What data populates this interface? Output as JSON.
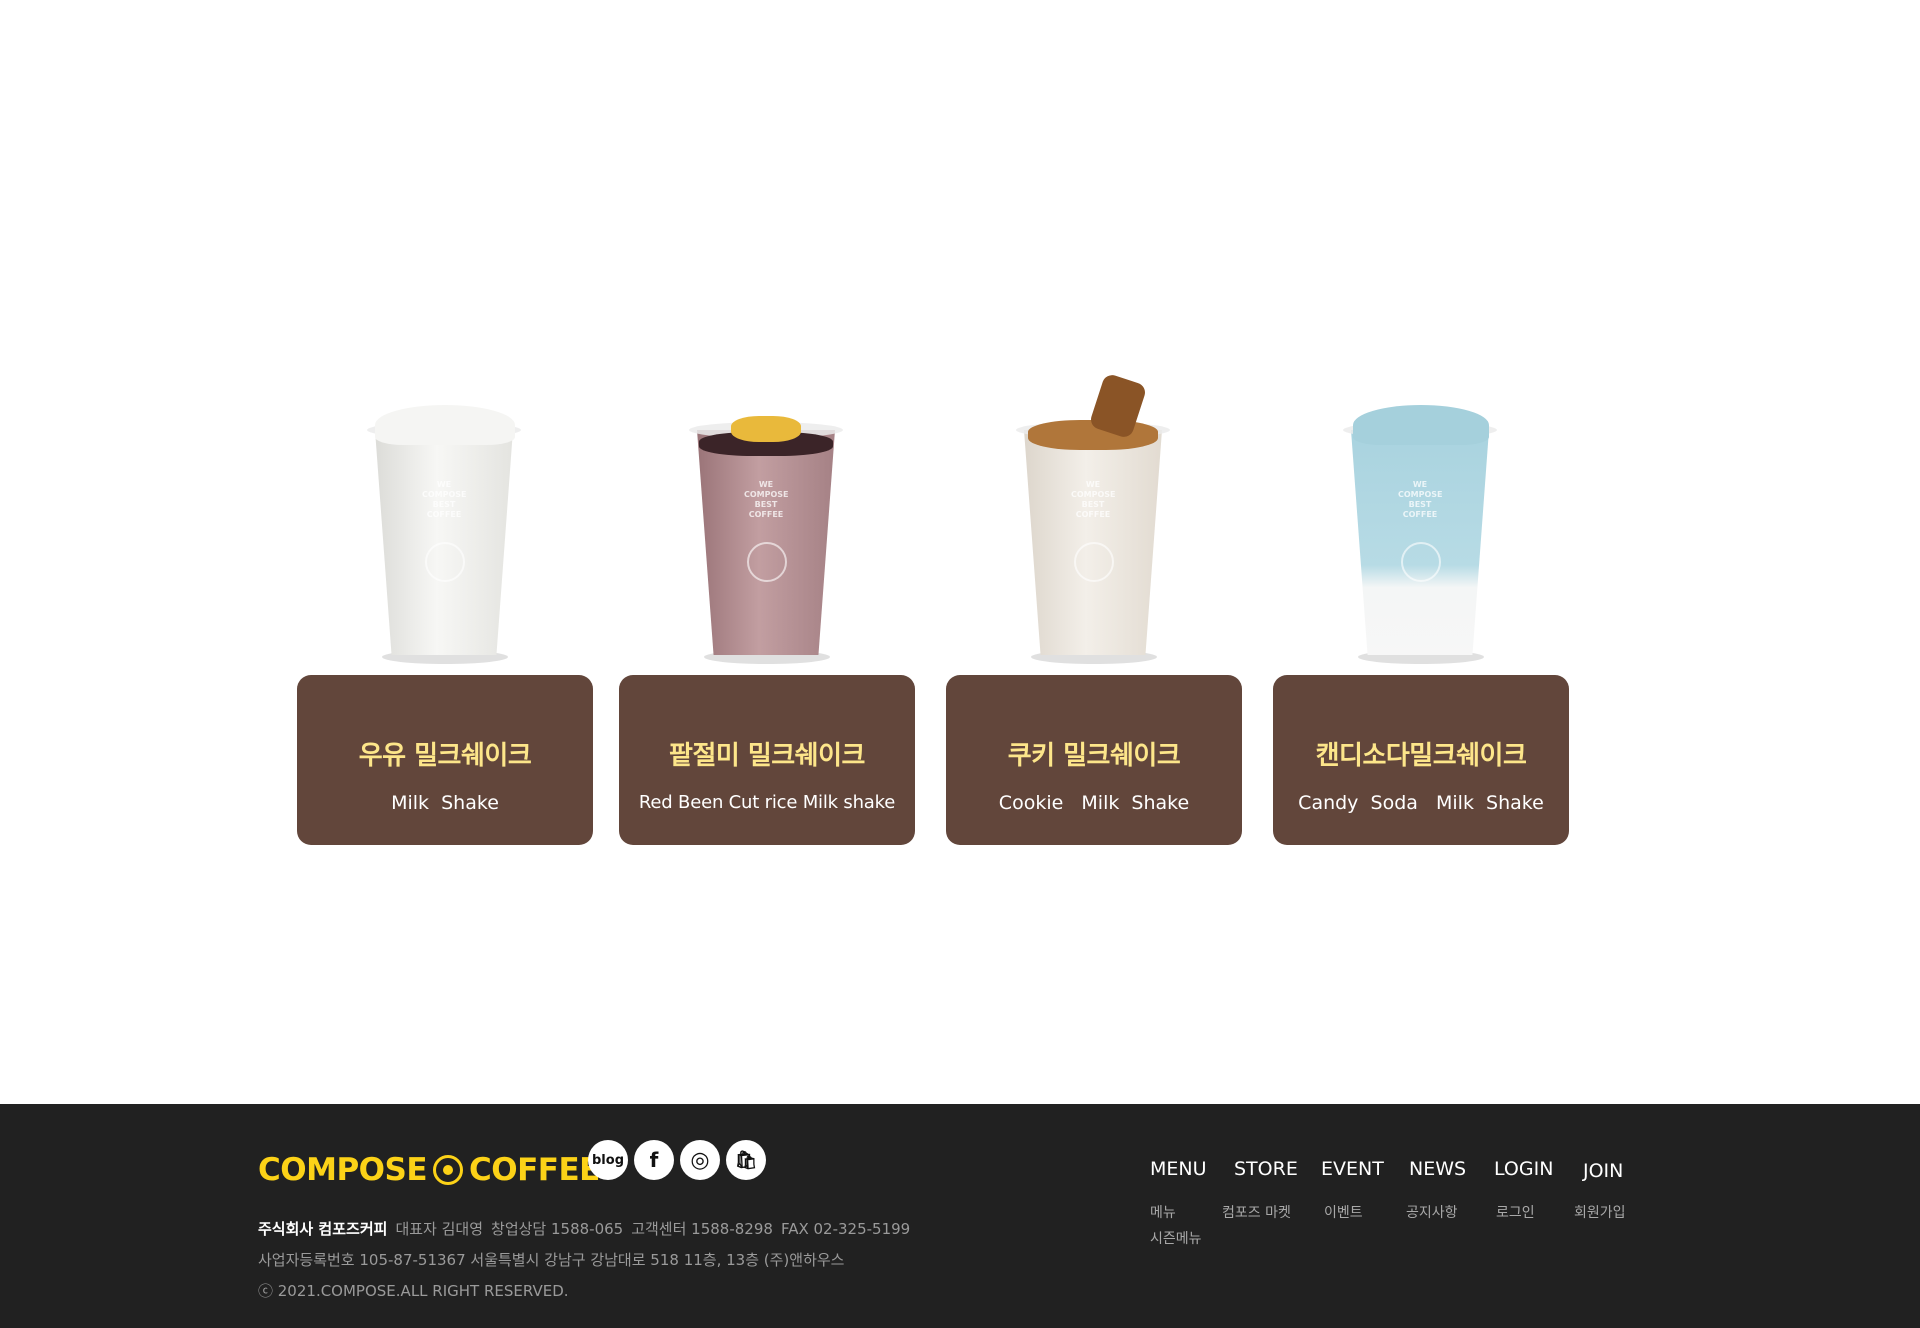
{
  "products": [
    {
      "name_ko": "우유 밀크쉐이크",
      "name_en": "Milk  Shake",
      "image_alt": "milk-shake",
      "color": "#f2f2f0"
    },
    {
      "name_ko": "팥절미 밀크쉐이크",
      "name_en": "Red Been Cut rice Milk shake",
      "image_alt": "red-bean-shake",
      "color": "#b08a8c"
    },
    {
      "name_ko": "쿠키 밀크쉐이크",
      "name_en": "Cookie   Milk  Shake",
      "image_alt": "cookie-shake",
      "color": "#ece8e2"
    },
    {
      "name_ko": "캔디소다밀크쉐이크",
      "name_en": "Candy  Soda   Milk  Shake",
      "image_alt": "candy-soda-shake",
      "color": "#a9d3df"
    }
  ],
  "cup_print": "WE COMPOSE BEST COFFEE",
  "footer": {
    "logo_left": "COMPOSE",
    "logo_right": "COFFEE",
    "socials": {
      "blog": "blog",
      "facebook": "f",
      "instagram": "◎",
      "shop": "🛍"
    },
    "company_name": "주식회사 컴포즈커피",
    "ceo": "대표자 김대영",
    "startup": "창업상담 1588-065",
    "cs": "고객센터 1588-8298",
    "fax": "FAX 02-325-5199",
    "registration": "사업자등록번호 105-87-51367 서울특별시 강남구 강남대로 518 11층, 13층 (주)앤하우스",
    "copyright": "ⓒ 2021.COMPOSE.ALL RIGHT RESERVED.",
    "nav": [
      "MENU",
      "STORE",
      "EVENT",
      "NEWS",
      "LOGIN",
      "JOIN"
    ],
    "subnav": [
      "메뉴",
      "컴포즈 마켓",
      "이벤트",
      "공지사항",
      "로그인",
      "회원가입"
    ],
    "subnav_extra": "시즌메뉴"
  },
  "colors": {
    "card_bg": "#62463b",
    "card_title": "#fde68a",
    "footer_bg": "#212121",
    "brand_yellow": "#fcd217"
  }
}
